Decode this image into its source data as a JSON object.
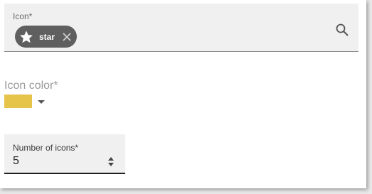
{
  "icon_field": {
    "label": "Icon*",
    "chip": {
      "icon": "star-icon",
      "text": "star"
    },
    "search_icon": "search-icon"
  },
  "icon_color": {
    "label": "Icon color*",
    "selected_color": "#e6c44a"
  },
  "number_of_icons": {
    "label": "Number of icons*",
    "value": "5"
  }
}
